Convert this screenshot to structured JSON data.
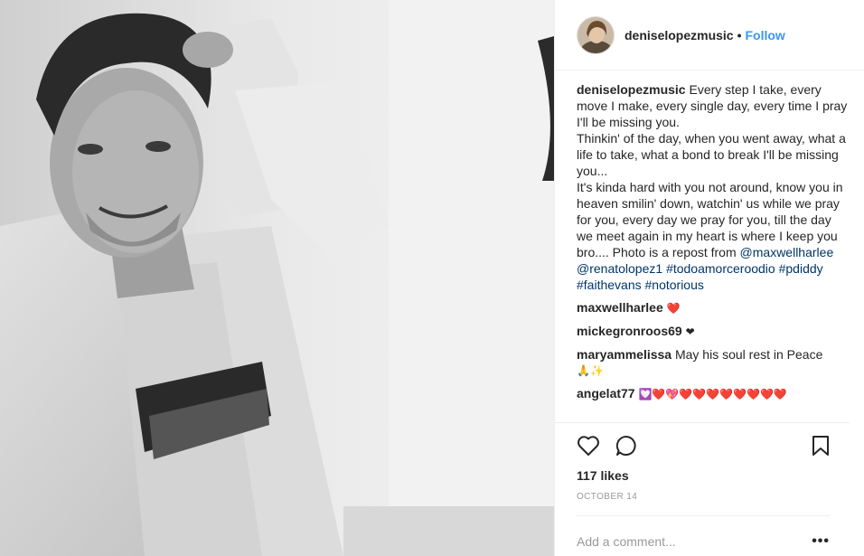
{
  "post": {
    "username": "deniselopezmusic",
    "separator": "•",
    "follow_label": "Follow",
    "caption_user": "deniselopezmusic",
    "caption_text": " Every step I take, every move I make, every single day, every time I pray I'll be missing you.",
    "caption_line2": "Thinkin' of the day, when you went away, what a life to take, what a bond to break I'll be missing you...",
    "caption_line3": "It's kinda hard with you not around, know you in heaven smilin' down, watchin' us while we pray for you, every day we pray for you, till the day we meet again in my heart is where I keep you bro.... Photo is a repost from ",
    "mention1": "@maxwellharlee",
    "mention2": "@renatolopez1",
    "tag1": "#todoamorceroodio",
    "tag2": "#pdiddy",
    "tag3": "#faithevans",
    "tag4": "#notorious"
  },
  "comments": [
    {
      "user": "maxwellharlee",
      "text": "❤️"
    },
    {
      "user": "mickegronroos69",
      "text": "❤"
    },
    {
      "user": "maryammelissa",
      "text": "May his soul rest in Peace",
      "text2": "🙏✨"
    },
    {
      "user": "angelat77",
      "text": "💟❤️💖❤️❤️❤️❤️❤️❤️❤️❤️"
    }
  ],
  "footer": {
    "likes": "117 likes",
    "date": "OCTOBER 14",
    "add_comment_placeholder": "Add a comment...",
    "more_label": "•••"
  },
  "icons": {
    "like": "heart-outline-icon",
    "comment": "comment-bubble-icon",
    "save": "bookmark-icon"
  },
  "colors": {
    "link": "#003569",
    "follow": "#3897f0",
    "heart": "#ed1d24"
  }
}
